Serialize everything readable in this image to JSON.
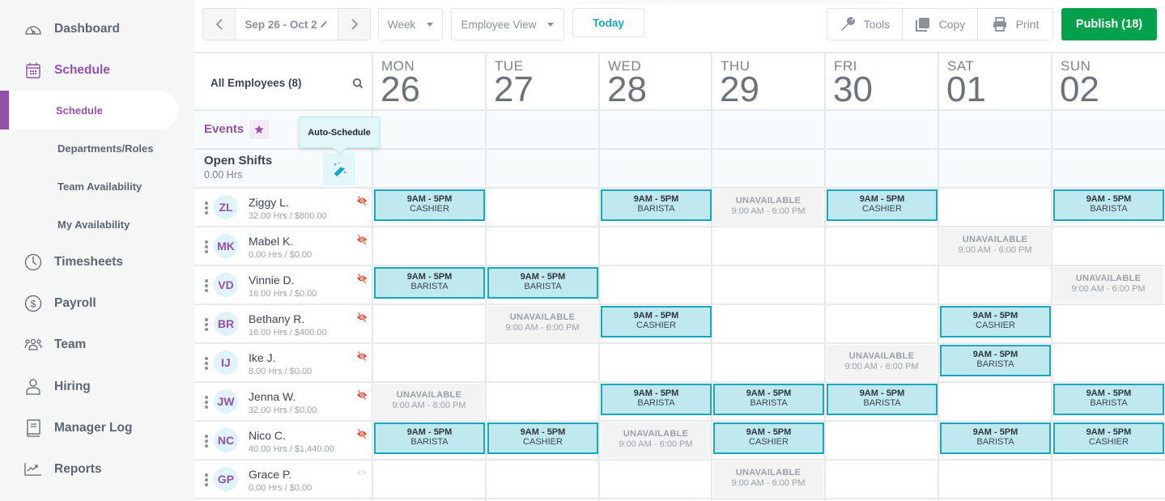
{
  "sidebar": {
    "items": [
      {
        "label": "Dashboard",
        "icon": "dashboard-icon"
      },
      {
        "label": "Schedule",
        "icon": "calendar-icon",
        "active": true
      },
      {
        "label": "Timesheets",
        "icon": "clock-icon"
      },
      {
        "label": "Payroll",
        "icon": "dollar-icon"
      },
      {
        "label": "Team",
        "icon": "team-icon"
      },
      {
        "label": "Hiring",
        "icon": "person-icon"
      },
      {
        "label": "Manager Log",
        "icon": "book-icon"
      },
      {
        "label": "Reports",
        "icon": "chart-icon"
      }
    ],
    "sub_items": [
      {
        "label": "Schedule",
        "active": true
      },
      {
        "label": "Departments/Roles"
      },
      {
        "label": "Team Availability"
      },
      {
        "label": "My Availability"
      }
    ]
  },
  "toolbar": {
    "date_range": "Sep 26 - Oct 2",
    "period_select": "Week",
    "view_select": "Employee View",
    "today_label": "Today",
    "tools_label": "Tools",
    "copy_label": "Copy",
    "print_label": "Print",
    "publish_label": "Publish (18)"
  },
  "grid": {
    "employee_filter": "All Employees (8)",
    "events_label": "Events",
    "open_shifts_label": "Open Shifts",
    "open_shifts_hours": "0.00 Hrs",
    "auto_schedule_tooltip": "Auto-Schedule",
    "days": [
      {
        "dow": "MON",
        "num": "26"
      },
      {
        "dow": "TUE",
        "num": "27"
      },
      {
        "dow": "WED",
        "num": "28"
      },
      {
        "dow": "THU",
        "num": "29"
      },
      {
        "dow": "FRI",
        "num": "30"
      },
      {
        "dow": "SAT",
        "num": "01"
      },
      {
        "dow": "SUN",
        "num": "02"
      }
    ],
    "unavailable_label": "UNAVAILABLE",
    "unavailable_time": "9:00 AM - 6:00 PM",
    "shift_time": "9AM - 5PM",
    "employees": [
      {
        "initials": "ZL",
        "name": "Ziggy L.",
        "stats": "32.00 Hrs / $800.00",
        "hidden": true,
        "cells": [
          {
            "type": "shift",
            "role": "CASHIER"
          },
          null,
          {
            "type": "shift",
            "role": "BARISTA"
          },
          {
            "type": "unavailable"
          },
          {
            "type": "shift",
            "role": "CASHIER"
          },
          null,
          {
            "type": "shift",
            "role": "BARISTA"
          }
        ]
      },
      {
        "initials": "MK",
        "name": "Mabel K.",
        "stats": "0.00 Hrs / $0.00",
        "hidden": true,
        "cells": [
          null,
          null,
          null,
          null,
          null,
          {
            "type": "unavailable"
          },
          null
        ]
      },
      {
        "initials": "VD",
        "name": "Vinnie D.",
        "stats": "16.00 Hrs / $0.00",
        "hidden": true,
        "cells": [
          {
            "type": "shift",
            "role": "BARISTA"
          },
          {
            "type": "shift",
            "role": "BARISTA"
          },
          null,
          null,
          null,
          null,
          {
            "type": "unavailable"
          }
        ]
      },
      {
        "initials": "BR",
        "name": "Bethany R.",
        "stats": "16.00 Hrs / $400.00",
        "hidden": true,
        "cells": [
          null,
          {
            "type": "unavailable"
          },
          {
            "type": "shift",
            "role": "CASHIER"
          },
          null,
          null,
          {
            "type": "shift",
            "role": "CASHIER"
          },
          null
        ]
      },
      {
        "initials": "IJ",
        "name": "Ike J.",
        "stats": "8.00 Hrs / $0.00",
        "hidden": true,
        "cells": [
          null,
          null,
          null,
          null,
          {
            "type": "unavailable"
          },
          {
            "type": "shift",
            "role": "BARISTA"
          },
          null
        ]
      },
      {
        "initials": "JW",
        "name": "Jenna W.",
        "stats": "32.00 Hrs / $0.00",
        "hidden": true,
        "cells": [
          {
            "type": "unavailable"
          },
          null,
          {
            "type": "shift",
            "role": "BARISTA"
          },
          {
            "type": "shift",
            "role": "BARISTA"
          },
          {
            "type": "shift",
            "role": "BARISTA"
          },
          null,
          {
            "type": "shift",
            "role": "BARISTA"
          }
        ]
      },
      {
        "initials": "NC",
        "name": "Nico C.",
        "stats": "40.00 Hrs / $1,440.00",
        "hidden": true,
        "cells": [
          {
            "type": "shift",
            "role": "BARISTA"
          },
          {
            "type": "shift",
            "role": "CASHIER"
          },
          {
            "type": "unavailable"
          },
          {
            "type": "shift",
            "role": "CASHIER"
          },
          null,
          {
            "type": "shift",
            "role": "BARISTA"
          },
          {
            "type": "shift",
            "role": "CASHIER"
          }
        ]
      },
      {
        "initials": "GP",
        "name": "Grace P.",
        "stats": "0.00 Hrs / $0.00",
        "hidden": false,
        "cells": [
          null,
          null,
          null,
          {
            "type": "unavailable"
          },
          null,
          null,
          null
        ]
      }
    ]
  },
  "colors": {
    "accent_purple": "#9650a9",
    "shift_fill": "#bfe9ef",
    "shift_border": "#1aa7bd",
    "publish_green": "#04a04c",
    "hidden_eye_red": "#e8533a"
  }
}
